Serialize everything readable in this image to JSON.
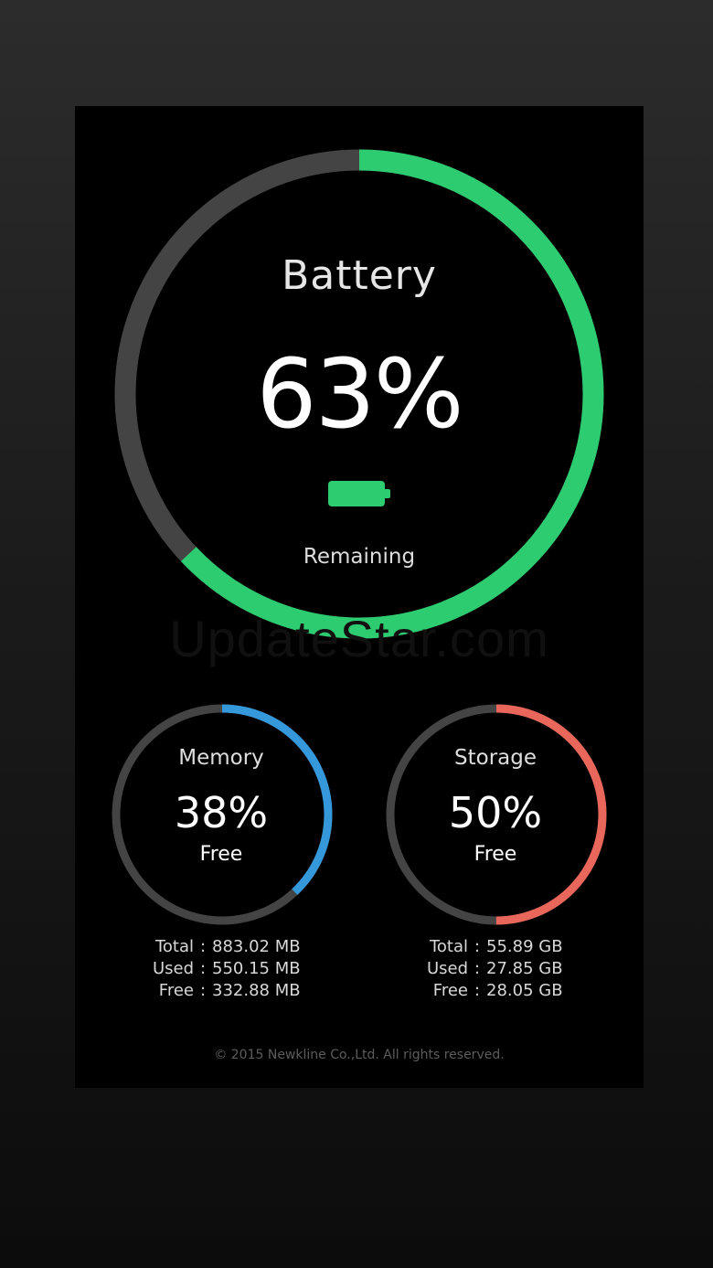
{
  "colors": {
    "battery_accent": "#2ecc71",
    "memory_accent": "#3498db",
    "storage_accent": "#e8675a",
    "track": "#444444"
  },
  "battery": {
    "title": "Battery",
    "value_label": "63%",
    "level": 0.63,
    "subtitle": "Remaining",
    "icon": "battery-icon"
  },
  "watermark": "UpdateStar.com",
  "memory": {
    "title": "Memory",
    "value_label": "38%",
    "fraction": 0.38,
    "subtitle": "Free",
    "stats": [
      {
        "label": "Total",
        "sep": ":",
        "value": "883.02 MB"
      },
      {
        "label": "Used",
        "sep": ":",
        "value": "550.15 MB"
      },
      {
        "label": "Free",
        "sep": ":",
        "value": "332.88 MB"
      }
    ]
  },
  "storage": {
    "title": "Storage",
    "value_label": "50%",
    "fraction": 0.5,
    "subtitle": "Free",
    "stats": [
      {
        "label": "Total",
        "sep": ":",
        "value": "55.89 GB"
      },
      {
        "label": "Used",
        "sep": ":",
        "value": "27.85 GB"
      },
      {
        "label": "Free",
        "sep": ":",
        "value": "28.05 GB"
      }
    ]
  },
  "footer": {
    "copyright": "© 2015 Newkline Co.,Ltd. All rights reserved."
  }
}
